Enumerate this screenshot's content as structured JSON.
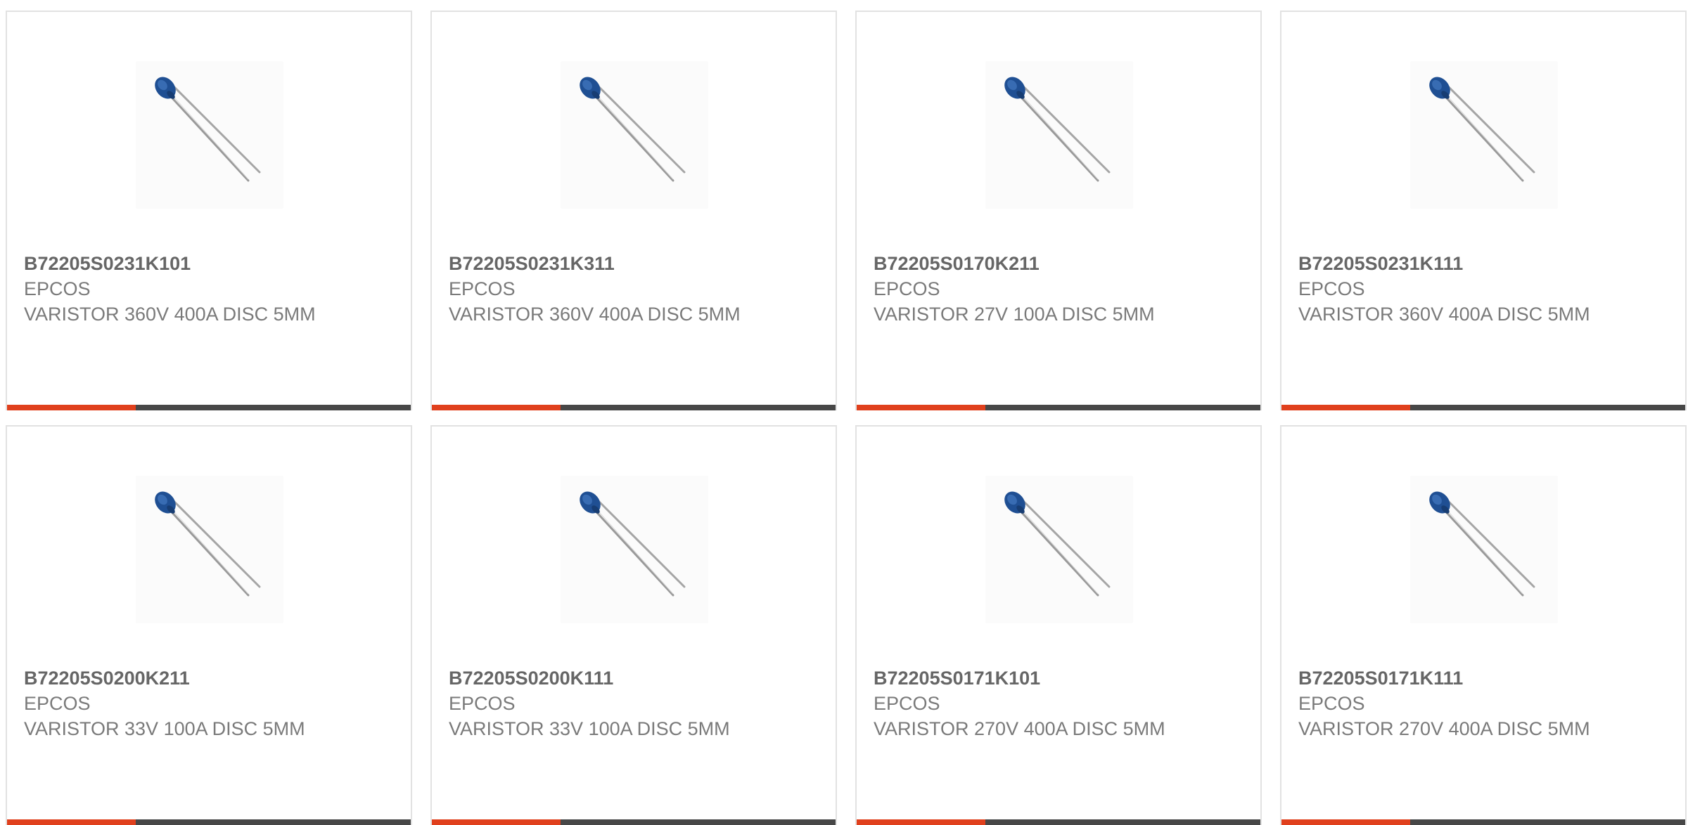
{
  "colors": {
    "accent_orange": "#e0401d",
    "accent_dark": "#474747",
    "component_blue": "#1f4f93",
    "text_gray": "#7a7a7a"
  },
  "products": [
    {
      "part_number": "B72205S0231K101",
      "manufacturer": "EPCOS",
      "description": "VARISTOR 360V 400A DISC 5MM",
      "image_icon": "varistor-image"
    },
    {
      "part_number": "B72205S0231K311",
      "manufacturer": "EPCOS",
      "description": "VARISTOR 360V 400A DISC 5MM",
      "image_icon": "varistor-image"
    },
    {
      "part_number": "B72205S0170K211",
      "manufacturer": "EPCOS",
      "description": "VARISTOR 27V 100A DISC 5MM",
      "image_icon": "varistor-image"
    },
    {
      "part_number": "B72205S0231K111",
      "manufacturer": "EPCOS",
      "description": "VARISTOR 360V 400A DISC 5MM",
      "image_icon": "varistor-image"
    },
    {
      "part_number": "B72205S0200K211",
      "manufacturer": "EPCOS",
      "description": "VARISTOR 33V 100A DISC 5MM",
      "image_icon": "varistor-image"
    },
    {
      "part_number": "B72205S0200K111",
      "manufacturer": "EPCOS",
      "description": "VARISTOR 33V 100A DISC 5MM",
      "image_icon": "varistor-image"
    },
    {
      "part_number": "B72205S0171K101",
      "manufacturer": "EPCOS",
      "description": "VARISTOR 270V 400A DISC 5MM",
      "image_icon": "varistor-image"
    },
    {
      "part_number": "B72205S0171K111",
      "manufacturer": "EPCOS",
      "description": "VARISTOR 270V 400A DISC 5MM",
      "image_icon": "varistor-image"
    }
  ]
}
